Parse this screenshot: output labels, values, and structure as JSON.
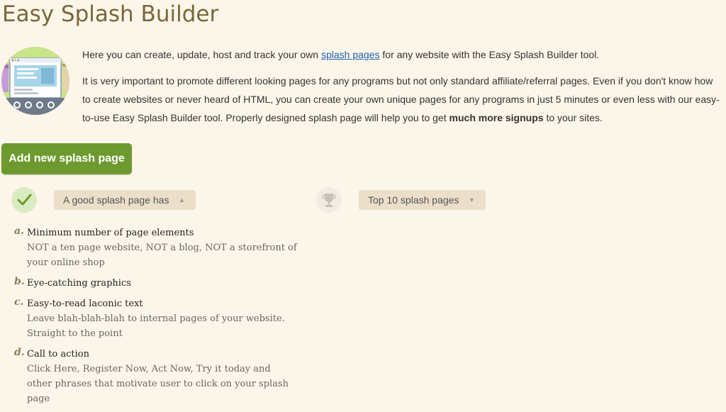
{
  "page": {
    "title": "Easy Splash Builder"
  },
  "intro": {
    "p1_before": "Here you can create, update, host and track your own ",
    "p1_link": "splash pages",
    "p1_after": " for any website with the Easy Splash Builder tool.",
    "p2_before": "It is very important to promote different looking pages for any programs but not only standard affiliate/referral pages. Even if you don't know how to create websites or never heard of HTML, you can create your own unique pages for any programs in just 5 minutes or even less with our easy-to-use Easy Splash Builder tool. Properly designed splash page will help you to get ",
    "p2_bold": "much more signups",
    "p2_after": " to your sites."
  },
  "actions": {
    "add_label": "Add new splash page"
  },
  "sections": {
    "good_label": "A good splash page has",
    "good_arrow": "▲",
    "top_label": "Top 10 splash pages",
    "top_arrow": "▼"
  },
  "tips": [
    {
      "letter": "a.",
      "head": "Minimum number of page elements",
      "desc": "NOT a ten page website, NOT a blog, NOT a storefront of your online shop"
    },
    {
      "letter": "b.",
      "head": "Eye-catching graphics",
      "desc": ""
    },
    {
      "letter": "c.",
      "head": "Easy-to-read laconic text",
      "desc": "Leave blah-blah-blah to internal pages of your website. Straight to the point"
    },
    {
      "letter": "d.",
      "head": "Call to action",
      "desc": "Click Here, Register Now, Act Now, Try it today and other phrases that motivate user to click on your splash page"
    }
  ],
  "icons": {
    "illustration": "splash-builder-illustration",
    "check": "check-icon",
    "trophy": "trophy-icon"
  },
  "colors": {
    "background": "#fcf6ea",
    "title": "#7a6638",
    "button": "#6d9a2e",
    "link": "#1f5fb0",
    "pill": "#ebdfc9"
  }
}
